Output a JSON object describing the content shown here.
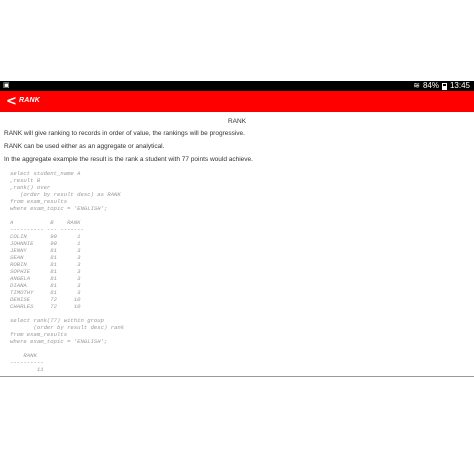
{
  "status_bar": {
    "left_icon": "screenshot-icon",
    "battery": "84%",
    "time": "13:45"
  },
  "app_bar": {
    "title": "RANK",
    "back_icon": "back-chevron-icon",
    "color": "#ff0000"
  },
  "content": {
    "heading": "RANK",
    "paragraphs": [
      "RANK will give ranking to records in order of value, the rankings will be progressive.",
      "RANK can be used either as an aggregate or analytical.",
      "In the aggregate example the result is the rank a student with 77 points would achieve."
    ],
    "code_lines": [
      "select student_name A",
      ",result B",
      ",rank() over",
      "   (order by result desc) as RANK",
      "from exam_results",
      "where exam_topic = 'ENGLISH';",
      "",
      "A           B    RANK",
      "---------- --- -------",
      "COLIN       90      1",
      "JOHNNIE     90      1",
      "JENNY       81      3",
      "SEAN        81      3",
      "ROBIN       81      3",
      "SOPHIE      81      3",
      "ANGELA      81      3",
      "DIANA       81      3",
      "TIMOTHY     81      3",
      "DENISE      72     10",
      "CHARLES     72     10",
      "",
      "select rank(77) within group",
      "       (order by result desc) rank",
      "from exam_results",
      "where exam_topic = 'ENGLISH';",
      "",
      "    RANK",
      "----------",
      "        11"
    ]
  }
}
